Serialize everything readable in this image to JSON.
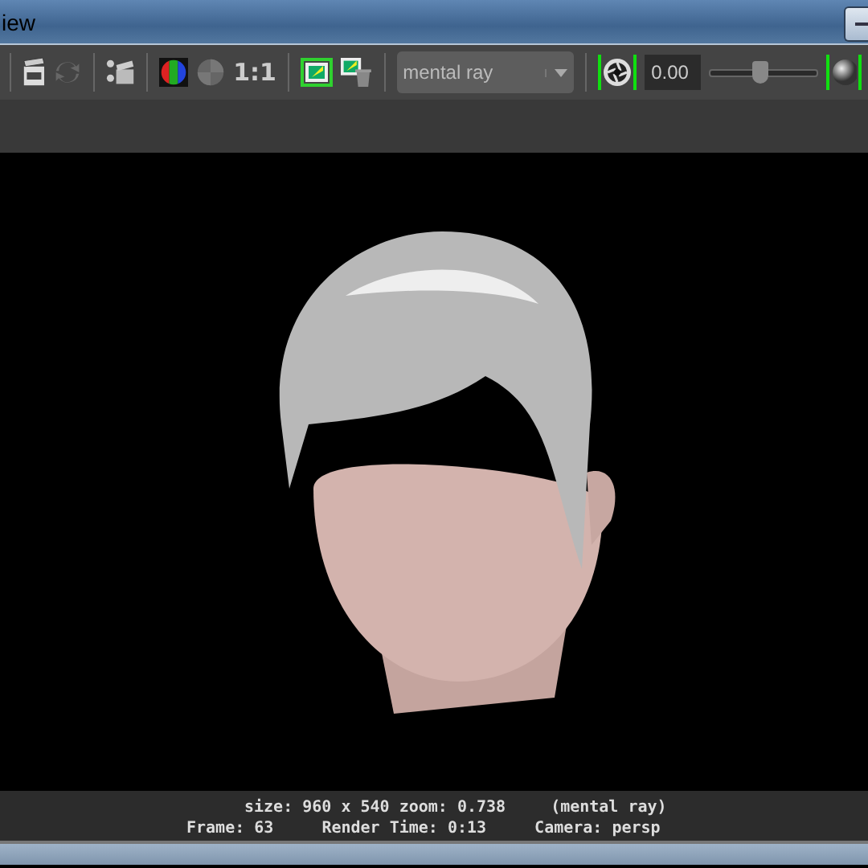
{
  "window": {
    "title": "iew"
  },
  "toolbar": {
    "zoom_label": "1:1",
    "display_toggle": {
      "on": true
    },
    "renderer": {
      "value": "mental ray"
    },
    "exposure_toggle": {
      "on": true
    },
    "exposure": {
      "value": "0.00"
    },
    "gamma_slider": {
      "level": 0.48
    },
    "gamma_toggle": {
      "on": true
    }
  },
  "status": {
    "size": "size: 960 x 540 zoom: 0.738",
    "renderer": "(mental ray)",
    "frame": "Frame: 63",
    "render_time": "Render Time: 0:13",
    "camera": "Camera: persp"
  }
}
